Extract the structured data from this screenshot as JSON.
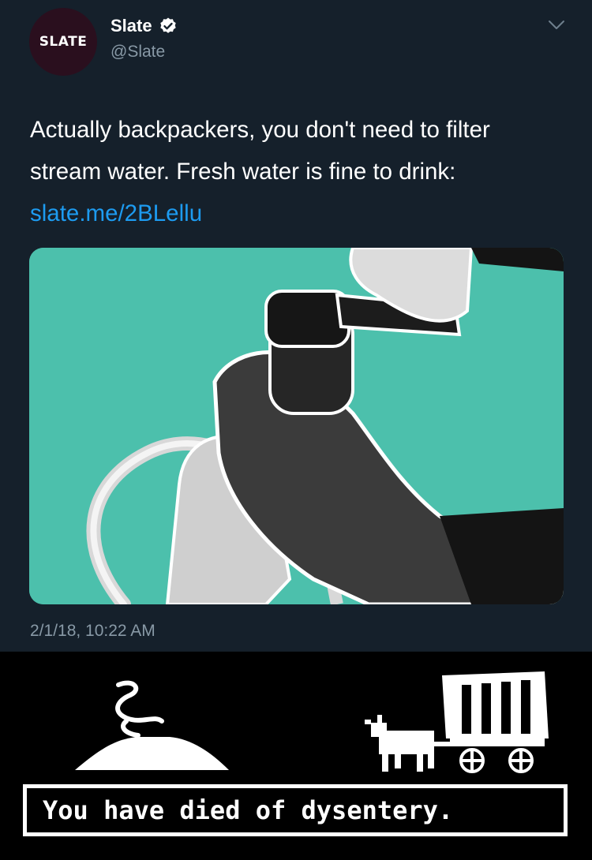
{
  "account": {
    "avatar_text": "SLATE",
    "name": "Slate",
    "handle": "@Slate"
  },
  "tweet": {
    "text": "Actually backpackers, you don't need to filter stream water. Fresh water is fine to drink: ",
    "link": "slate.me/2BLellu",
    "timestamp": "2/1/18, 10:22 AM"
  },
  "icons": {
    "verified": "verified-badge-icon",
    "menu": "chevron-down-icon"
  },
  "colors": {
    "background": "#15202b",
    "link": "#1d9bf0",
    "photo_bg": "#4cc0ac"
  },
  "meme": {
    "caption": "You have died of dysentery."
  }
}
